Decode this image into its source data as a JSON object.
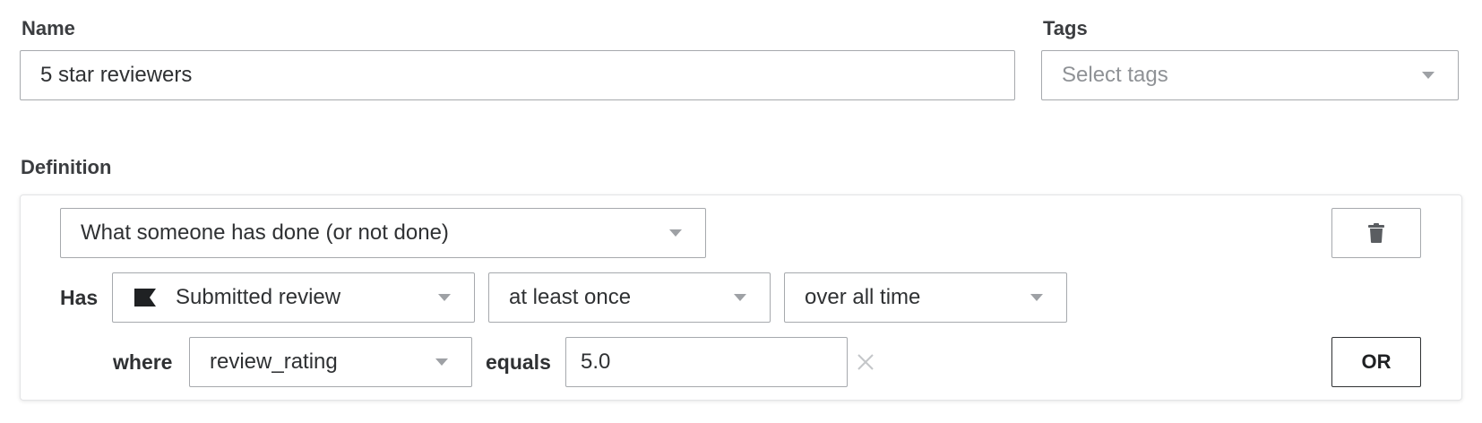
{
  "name_field": {
    "label": "Name",
    "value": "5 star reviewers"
  },
  "tags_field": {
    "label": "Tags",
    "placeholder": "Select tags"
  },
  "definition": {
    "label": "Definition",
    "condition_type": "What someone has done (or not done)",
    "has_label": "Has",
    "event": "Submitted review",
    "frequency": "at least once",
    "timeframe": "over all time",
    "where_label": "where",
    "property": "review_rating",
    "operator_label": "equals",
    "value": "5.0",
    "or_label": "OR"
  },
  "icons": {
    "event": "flag-icon",
    "delete": "trash-icon",
    "clear": "close-icon",
    "dropdown": "caret-down-icon"
  }
}
